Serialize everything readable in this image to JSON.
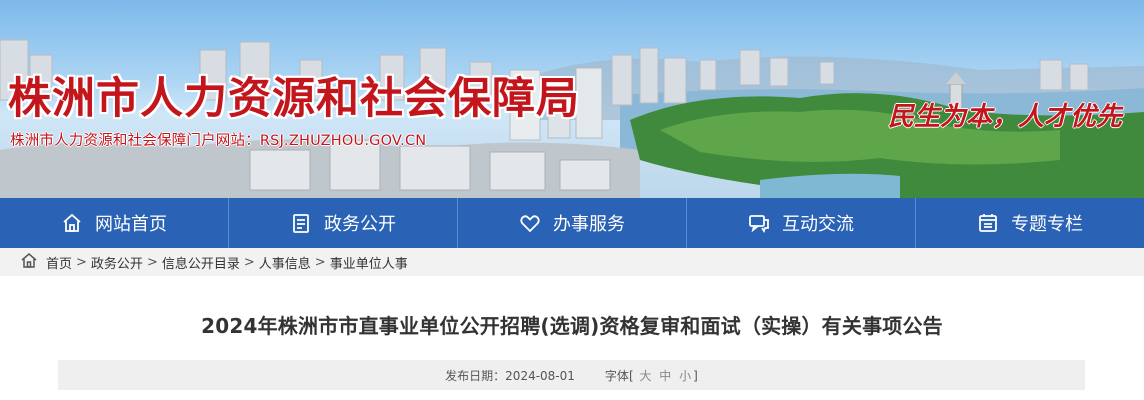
{
  "header": {
    "title": "株洲市人力资源和社会保障局",
    "subtitle": "株洲市人力资源和社会保障门户网站：RSJ.ZHUZHOU.GOV.CN",
    "slogan": "民生为本，人才优先"
  },
  "nav": {
    "items": [
      {
        "label": "网站首页",
        "icon": "home-icon"
      },
      {
        "label": "政务公开",
        "icon": "document-icon"
      },
      {
        "label": "办事服务",
        "icon": "heart-icon"
      },
      {
        "label": "互动交流",
        "icon": "chat-icon"
      },
      {
        "label": "专题专栏",
        "icon": "topic-icon"
      }
    ]
  },
  "breadcrumb": {
    "items": [
      "首页",
      "政务公开",
      "信息公开目录",
      "人事信息",
      "事业单位人事"
    ],
    "separator": ">"
  },
  "article": {
    "title": "2024年株洲市市直事业单位公开招聘(选调)资格复审和面试（实操）有关事项公告",
    "date_label": "发布日期：",
    "date": "2024-08-01",
    "font_label": "字体",
    "font_open": "[",
    "font_large": "大",
    "font_medium": "中",
    "font_small": "小",
    "font_close": "]"
  },
  "colors": {
    "nav_bg": "#2a62b5",
    "title_red": "#c3161c",
    "crumb_bg": "#f2f2f2"
  }
}
